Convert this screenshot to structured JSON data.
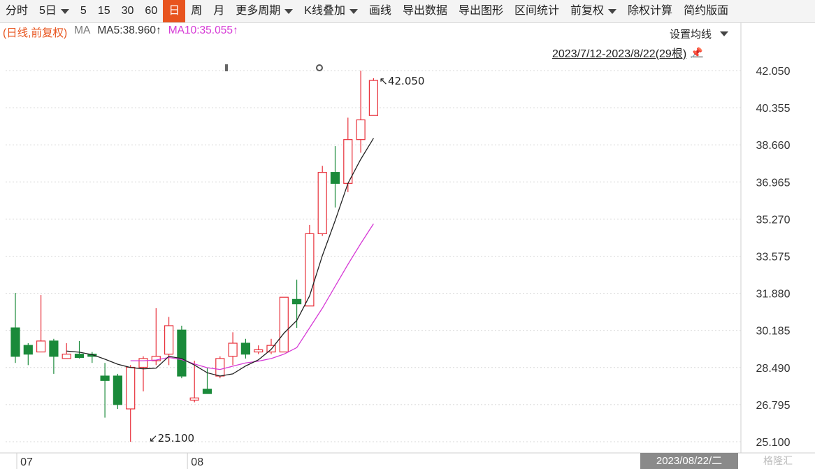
{
  "toolbar": {
    "items": [
      {
        "label": "分时",
        "dropdown": false,
        "active": false
      },
      {
        "label": "5日",
        "dropdown": true,
        "active": false
      },
      {
        "label": "5",
        "dropdown": false,
        "active": false
      },
      {
        "label": "15",
        "dropdown": false,
        "active": false
      },
      {
        "label": "30",
        "dropdown": false,
        "active": false
      },
      {
        "label": "60",
        "dropdown": false,
        "active": false
      },
      {
        "label": "日",
        "dropdown": false,
        "active": true
      },
      {
        "label": "周",
        "dropdown": false,
        "active": false
      },
      {
        "label": "月",
        "dropdown": false,
        "active": false
      },
      {
        "label": "更多周期",
        "dropdown": true,
        "active": false
      },
      {
        "label": "K线叠加",
        "dropdown": true,
        "active": false
      },
      {
        "label": "画线",
        "dropdown": false,
        "active": false
      },
      {
        "label": "导出数据",
        "dropdown": false,
        "active": false
      },
      {
        "label": "导出图形",
        "dropdown": false,
        "active": false
      },
      {
        "label": "区间统计",
        "dropdown": false,
        "active": false
      },
      {
        "label": "前复权",
        "dropdown": true,
        "active": false
      },
      {
        "label": "除权计算",
        "dropdown": false,
        "active": false
      },
      {
        "label": "简约版面",
        "dropdown": false,
        "active": false
      }
    ]
  },
  "info": {
    "period": "(日线,前复权)",
    "ma_label": "MA",
    "ma5": "MA5:38.960↑",
    "ma10": "MA10:35.055↑"
  },
  "settings_label": "设置均线",
  "date_range": "2023/7/12-2023/8/22(29根)",
  "bottom_date": "2023/08/22/二",
  "watermark": "格隆汇",
  "colors": {
    "up": "#e8303a",
    "down": "#1a8a3a",
    "ma5": "#222222",
    "ma10": "#d63ad6",
    "active_tab": "#e8541e"
  },
  "chart_data": {
    "type": "candlestick",
    "y_ticks": [
      "42.050",
      "40.355",
      "38.660",
      "36.965",
      "35.270",
      "33.575",
      "31.880",
      "30.185",
      "28.490",
      "26.795",
      "25.100"
    ],
    "ylim": [
      25.1,
      42.05
    ],
    "x_labels": [
      {
        "index": 0,
        "text": "07"
      },
      {
        "index": 14,
        "text": "08"
      }
    ],
    "annotations": [
      {
        "index": 28,
        "value": 42.05,
        "text": "42.050",
        "arrow": "↖"
      },
      {
        "index": 10,
        "value": 25.1,
        "text": "25.100",
        "arrow": "↙"
      }
    ],
    "candles": [
      {
        "o": 30.3,
        "h": 31.9,
        "l": 28.7,
        "c": 29.0
      },
      {
        "o": 29.5,
        "h": 29.6,
        "l": 28.6,
        "c": 29.1
      },
      {
        "o": 29.2,
        "h": 31.8,
        "l": 29.2,
        "c": 29.7
      },
      {
        "o": 29.7,
        "h": 29.8,
        "l": 28.2,
        "c": 29.0
      },
      {
        "o": 28.9,
        "h": 29.6,
        "l": 28.9,
        "c": 29.1
      },
      {
        "o": 29.1,
        "h": 29.7,
        "l": 28.9,
        "c": 28.95
      },
      {
        "o": 29.1,
        "h": 29.2,
        "l": 28.7,
        "c": 29.0
      },
      {
        "o": 28.1,
        "h": 28.7,
        "l": 26.2,
        "c": 27.9
      },
      {
        "o": 28.1,
        "h": 28.2,
        "l": 26.6,
        "c": 26.8
      },
      {
        "o": 26.6,
        "h": 28.6,
        "l": 25.1,
        "c": 28.5
      },
      {
        "o": 28.5,
        "h": 29.0,
        "l": 27.4,
        "c": 28.9
      },
      {
        "o": 28.8,
        "h": 31.2,
        "l": 28.6,
        "c": 29.0
      },
      {
        "o": 29.1,
        "h": 30.8,
        "l": 28.6,
        "c": 30.4
      },
      {
        "o": 30.2,
        "h": 30.4,
        "l": 28.0,
        "c": 28.1
      },
      {
        "o": 27.0,
        "h": 28.8,
        "l": 26.9,
        "c": 27.1
      },
      {
        "o": 27.5,
        "h": 28.5,
        "l": 27.3,
        "c": 27.3
      },
      {
        "o": 28.1,
        "h": 29.0,
        "l": 28.0,
        "c": 28.9
      },
      {
        "o": 29.0,
        "h": 30.1,
        "l": 28.6,
        "c": 29.6
      },
      {
        "o": 29.6,
        "h": 29.8,
        "l": 28.9,
        "c": 29.1
      },
      {
        "o": 29.2,
        "h": 29.5,
        "l": 29.1,
        "c": 29.3
      },
      {
        "o": 29.2,
        "h": 29.8,
        "l": 29.1,
        "c": 29.5
      },
      {
        "o": 29.2,
        "h": 31.7,
        "l": 29.2,
        "c": 31.7
      },
      {
        "o": 31.6,
        "h": 32.5,
        "l": 30.3,
        "c": 31.4
      },
      {
        "o": 31.3,
        "h": 35.0,
        "l": 31.3,
        "c": 34.6
      },
      {
        "o": 34.6,
        "h": 37.7,
        "l": 34.5,
        "c": 37.4
      },
      {
        "o": 37.4,
        "h": 38.6,
        "l": 35.8,
        "c": 36.9
      },
      {
        "o": 36.9,
        "h": 39.9,
        "l": 36.5,
        "c": 38.9
      },
      {
        "o": 38.9,
        "h": 42.05,
        "l": 38.3,
        "c": 39.8
      },
      {
        "o": 40.0,
        "h": 41.7,
        "l": 40.0,
        "c": 41.6
      }
    ],
    "ma5": [
      null,
      null,
      null,
      null,
      29.24,
      29.19,
      29.08,
      28.87,
      28.64,
      28.49,
      28.43,
      28.46,
      29.0,
      28.9,
      28.6,
      28.25,
      28.1,
      28.2,
      28.56,
      28.84,
      29.32,
      30.06,
      30.64,
      31.76,
      33.6,
      35.2,
      36.9,
      38.0,
      38.96
    ],
    "ma10": [
      null,
      null,
      null,
      null,
      null,
      null,
      null,
      null,
      null,
      28.8,
      28.8,
      28.83,
      28.95,
      28.85,
      28.65,
      28.48,
      28.4,
      28.55,
      28.7,
      28.78,
      28.9,
      29.1,
      29.4,
      30.3,
      31.2,
      32.2,
      33.2,
      34.15,
      35.055
    ]
  }
}
